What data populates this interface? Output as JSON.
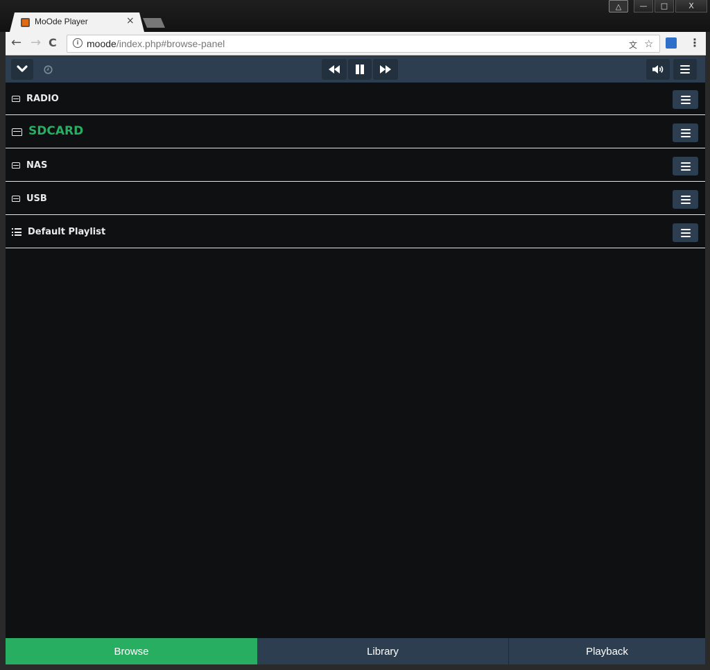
{
  "browser": {
    "tab_title": "MoOde Player",
    "tab_close": "×",
    "url_host": "moode",
    "url_path": "/index.php#browse-panel",
    "back": "←",
    "forward": "→",
    "reload": "C",
    "info": "i",
    "star": "☆",
    "translate": "文",
    "menu": "⋮",
    "window_buttons": {
      "minimize": "—",
      "maximize": "□",
      "close": "X"
    }
  },
  "player_bar": {
    "collapse_icon": "chevron-down-icon",
    "timer_icon": "clock-icon",
    "prev_icon": "fast-backward-icon",
    "pause_icon": "pause-icon",
    "next_icon": "fast-forward-icon",
    "volume_icon": "volume-icon",
    "menu_icon": "hamburger-icon"
  },
  "browse": {
    "items": [
      {
        "label": "RADIO",
        "icon": "drive-icon",
        "active": false
      },
      {
        "label": "SDCARD",
        "icon": "drive-icon",
        "active": true
      },
      {
        "label": "NAS",
        "icon": "drive-icon",
        "active": false
      },
      {
        "label": "USB",
        "icon": "drive-icon",
        "active": false
      },
      {
        "label": "Default Playlist",
        "icon": "list-icon",
        "active": false
      }
    ]
  },
  "bottom_tabs": {
    "browse": "Browse",
    "library": "Library",
    "playback": "Playback"
  },
  "colors": {
    "accent": "#27ae60",
    "bar": "#2c3e50",
    "background": "#0e1011"
  }
}
